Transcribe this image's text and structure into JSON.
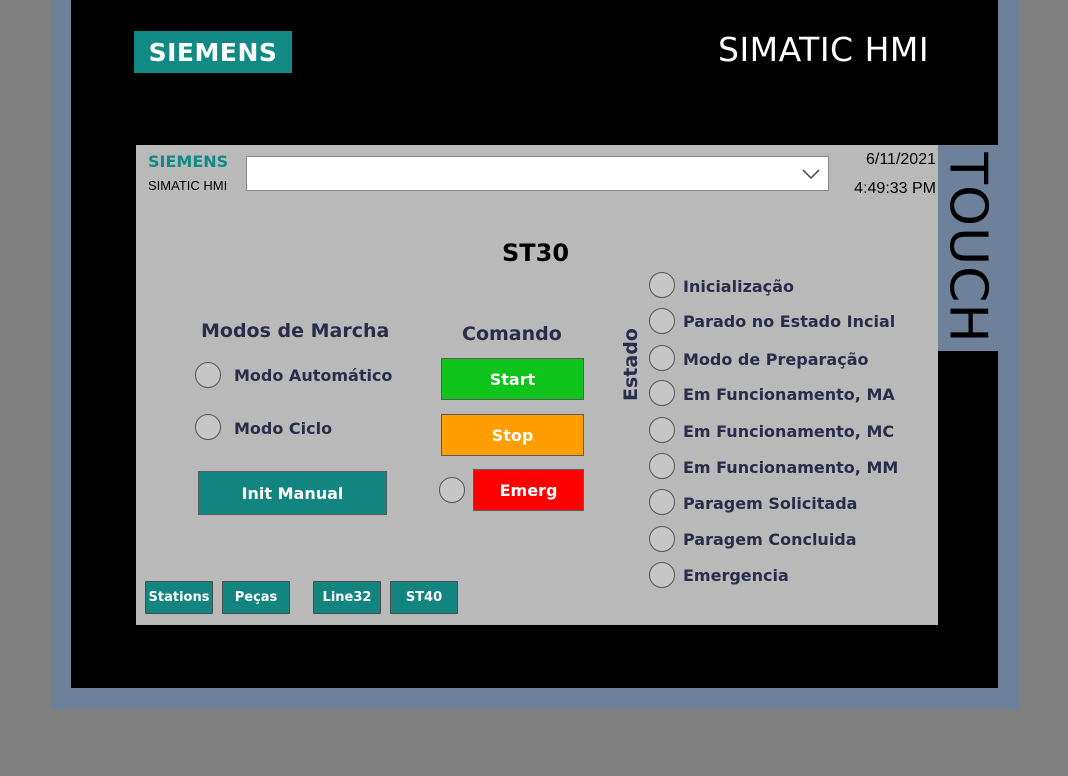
{
  "device": {
    "brand": "SIEMENS",
    "model": "SIMATIC HMI",
    "side_label": "TOUCH"
  },
  "header": {
    "logo": "SIEMENS",
    "subtitle": "SIMATIC HMI",
    "dropdown_value": "",
    "date": "6/11/2021",
    "time": "4:49:33 PM"
  },
  "station_title": "ST30",
  "modos": {
    "title": "Modos de Marcha",
    "items": [
      "Modo Automático",
      "Modo Ciclo"
    ],
    "init_button": "Init Manual"
  },
  "comando": {
    "title": "Comando",
    "start": "Start",
    "stop": "Stop",
    "emerg": "Emerg"
  },
  "estado": {
    "title": "Estado",
    "items": [
      "Inicialização",
      "Parado no Estado Incial",
      "Modo de Preparação",
      "Em Funcionamento, MA",
      "Em Funcionamento, MC",
      "Em Funcionamento, MM",
      "Paragem Solicitada",
      "Paragem Concluida",
      "Emergencia"
    ]
  },
  "nav": [
    "Stations",
    "Peças",
    "Line32",
    "ST40"
  ],
  "colors": {
    "teal": "#138580",
    "start": "#0fc41a",
    "stop": "#ff9e00",
    "emerg": "#ff0000",
    "bezel": "#6d829a"
  }
}
